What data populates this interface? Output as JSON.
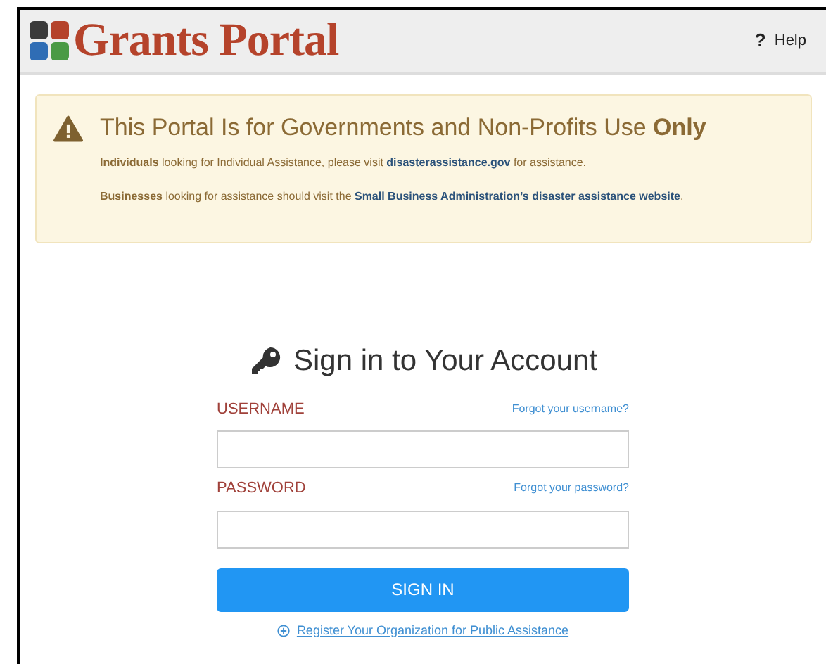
{
  "header": {
    "brand": "Grants Portal",
    "help": {
      "icon": "?",
      "label": "Help"
    }
  },
  "notice": {
    "title": "This Portal Is for Governments and Non-Profits Use **Only**",
    "paragraphs": [
      {
        "lead": "**Individuals** looking for Individual Assistance, please visit ",
        "link": "disasterassistance.gov",
        "tail": " for assistance."
      },
      {
        "lead": "**Businesses** looking for assistance should visit the ",
        "link": "Small Business Administration’s disaster assistance website",
        "tail": "."
      }
    ]
  },
  "signin": {
    "title": "Sign in to Your Account",
    "fields": [
      {
        "label": "USERNAME",
        "link": "Forgot your username?"
      },
      {
        "label": "PASSWORD",
        "link": "Forgot your password?"
      }
    ],
    "button": "SIGN IN",
    "register": "Register Your Organization for Public Assistance"
  }
}
